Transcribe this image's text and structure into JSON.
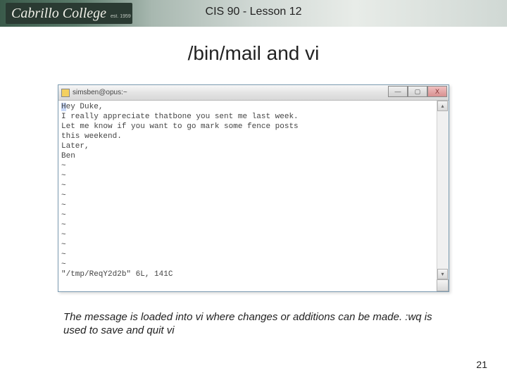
{
  "header": {
    "logo_text": "Cabrillo College",
    "logo_sub": "est. 1959",
    "course_title": "CIS 90 - Lesson 12"
  },
  "slide": {
    "title": "/bin/mail and vi",
    "caption": "The message is loaded into vi where changes or additions can be made.  :wq is used to save and quit vi",
    "page_number": "21"
  },
  "terminal": {
    "window_title": "simsben@opus:~",
    "win_min": "—",
    "win_max": "▢",
    "win_close": "X",
    "scroll_up": "▴",
    "scroll_down": "▾",
    "lines": [
      "Hey Duke,",
      "I really appreciate thatbone you sent me last week.",
      "Let me know if you want to go mark some fence posts",
      "this weekend.",
      "Later,",
      "Ben",
      "~",
      "~",
      "~",
      "~",
      "~",
      "~",
      "~",
      "~",
      "~",
      "~",
      "~",
      "\"/tmp/ReqY2d2b\" 6L, 141C"
    ]
  }
}
